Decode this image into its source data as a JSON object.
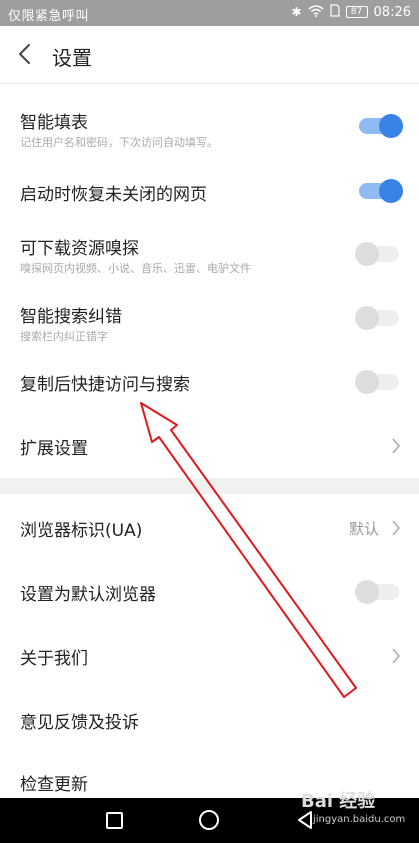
{
  "status_bar": {
    "left_text": "仅限紧急呼叫",
    "battery": "87",
    "time": "08:26"
  },
  "header": {
    "title": "设置"
  },
  "settings": {
    "smart_fill": {
      "label": "智能填表",
      "sub": "记住用户名和密码，下次访问自动填写。",
      "enabled": true
    },
    "restore_pages": {
      "label": "启动时恢复未关闭的网页",
      "enabled": true
    },
    "download_sniff": {
      "label": "可下载资源嗅探",
      "sub": "嗅探网页内视频、小说、音乐、迅雷、电驴文件",
      "enabled": false
    },
    "search_correct": {
      "label": "智能搜索纠错",
      "sub": "搜索栏内纠正错字",
      "enabled": false
    },
    "copy_quick": {
      "label": "复制后快捷访问与搜索",
      "enabled": false
    },
    "extended": {
      "label": "扩展设置"
    },
    "ua": {
      "label": "浏览器标识(UA)",
      "value": "默认"
    },
    "default_browser": {
      "label": "设置为默认浏览器",
      "enabled": false
    },
    "about": {
      "label": "关于我们"
    },
    "feedback": {
      "label": "意见反馈及投诉"
    },
    "check_update": {
      "label": "检查更新"
    }
  },
  "colors": {
    "toggle_on": "#3a83e6",
    "annotation_arrow": "#e0191e"
  },
  "watermark": {
    "brand": "Bai 经验",
    "url": "jingyan.baidu.com"
  }
}
